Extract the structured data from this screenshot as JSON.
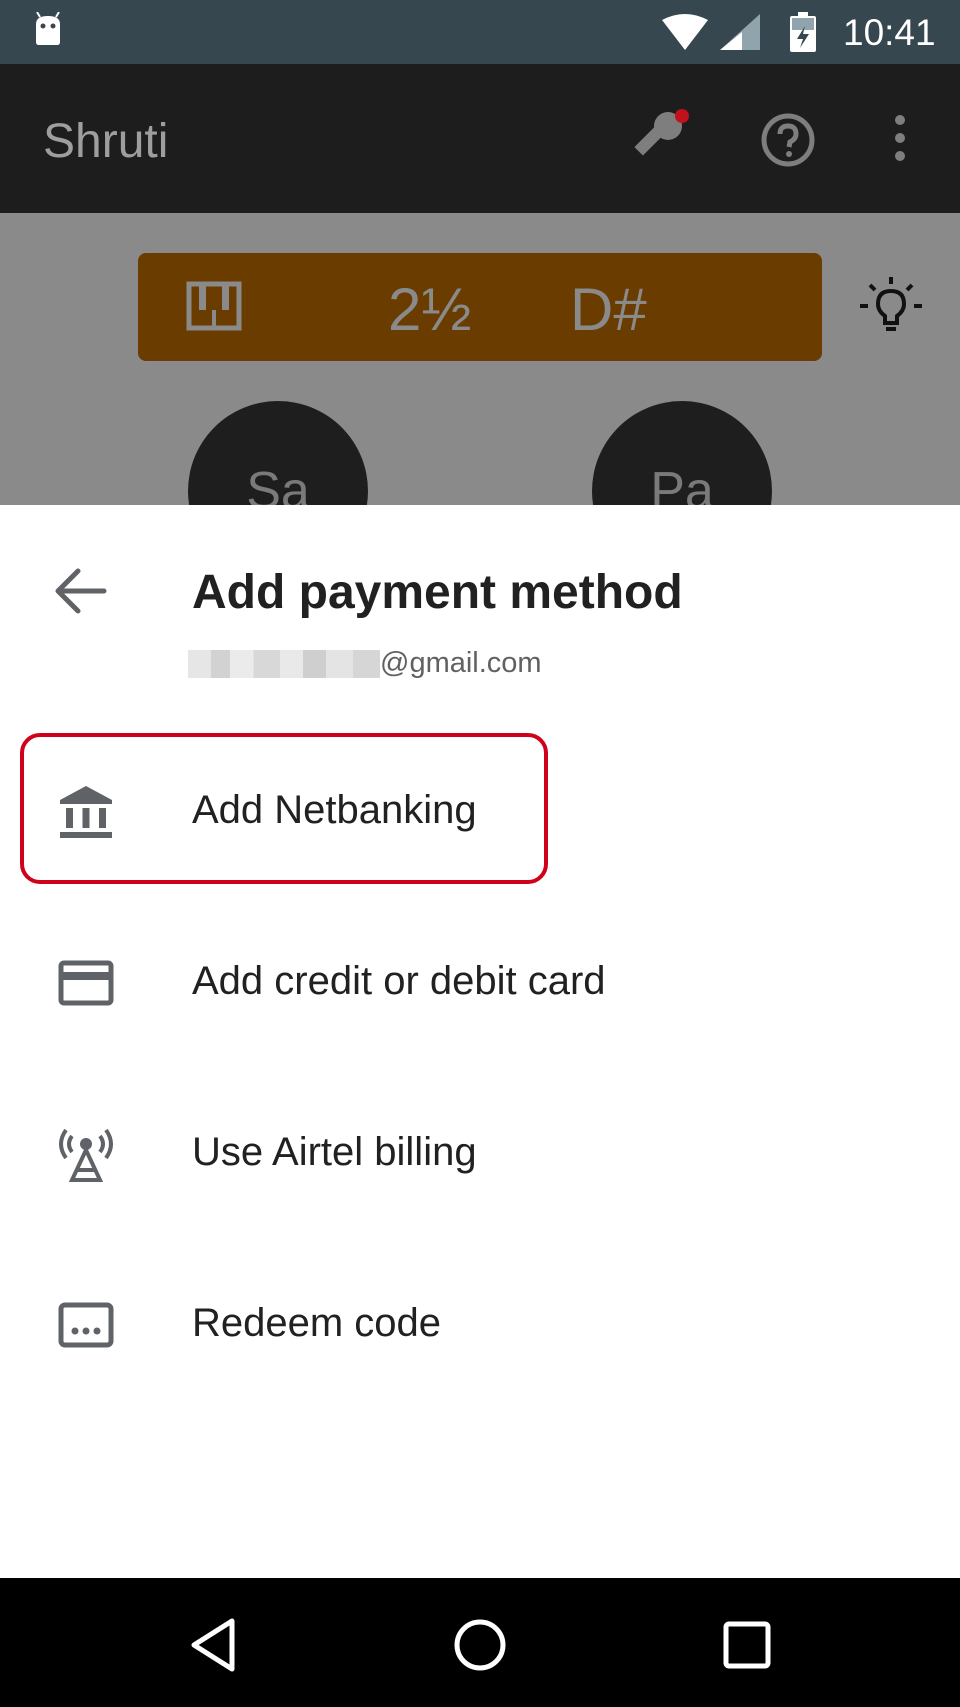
{
  "status_bar": {
    "time": "10:41",
    "icons": [
      "android-notification-icon",
      "wifi-icon",
      "signal-icon",
      "battery-charging-icon"
    ]
  },
  "app": {
    "title": "Shruti",
    "pitch_value": "2½",
    "pitch_note": "D#",
    "notes": [
      "Sa",
      "Pa"
    ],
    "accent_color": "#6b3c00"
  },
  "sheet": {
    "title": "Add payment method",
    "account_email_suffix": "@gmail.com",
    "options": [
      {
        "label": "Add Netbanking",
        "icon": "bank-icon"
      },
      {
        "label": "Add credit or debit card",
        "icon": "credit-card-icon"
      },
      {
        "label": "Use Airtel billing",
        "icon": "antenna-icon"
      },
      {
        "label": "Redeem code",
        "icon": "redeem-code-icon"
      }
    ],
    "highlight_color": "#d0021b"
  },
  "nav_bar": {
    "buttons": [
      "back-icon",
      "home-icon",
      "recents-icon"
    ]
  }
}
